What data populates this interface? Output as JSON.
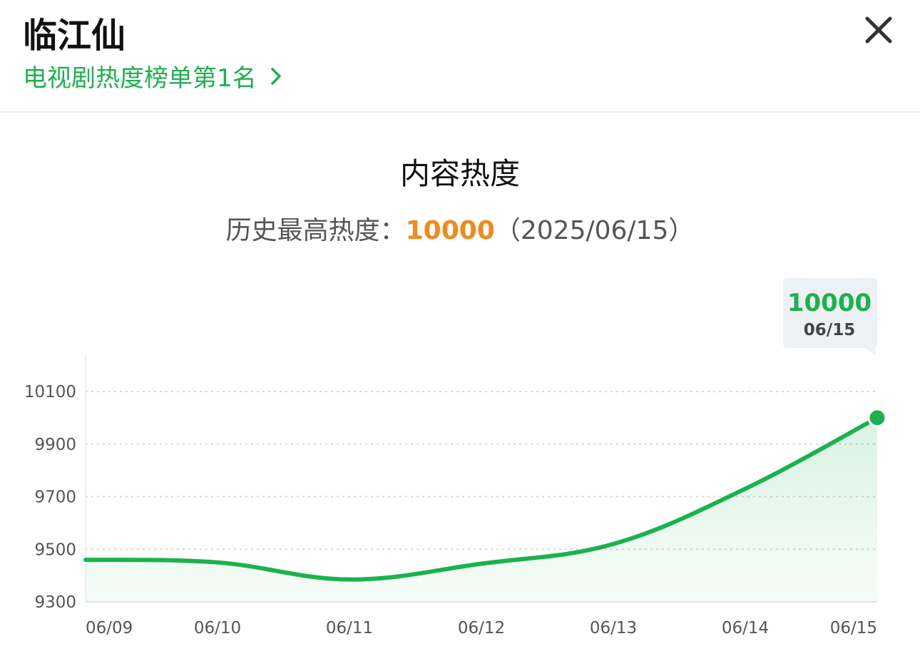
{
  "header": {
    "title": "临江仙",
    "rank_link": "电视剧热度榜单第1名"
  },
  "icons": {
    "close": "close-icon",
    "chevron": "chevron-right-icon"
  },
  "colors": {
    "accent": "#1bb24e",
    "peak": "#f08a1c"
  },
  "section": {
    "title": "内容热度",
    "peak_label": "历史最高热度：",
    "peak_value": "10000",
    "peak_date": "（2025/06/15）"
  },
  "tooltip": {
    "value": "10000",
    "date": "06/15"
  },
  "chart_data": {
    "type": "area",
    "x": [
      "06/09",
      "06/10",
      "06/11",
      "06/12",
      "06/13",
      "06/14",
      "06/15"
    ],
    "series": [
      {
        "values": [
          9460,
          9450,
          9385,
          9445,
          9520,
          9730,
          10000
        ]
      }
    ],
    "yticks": [
      9300,
      9500,
      9700,
      9900,
      10100
    ],
    "ylim": [
      9300,
      10200
    ],
    "grid": true,
    "highlighted_point": {
      "x": "06/15",
      "y": 10000
    }
  }
}
